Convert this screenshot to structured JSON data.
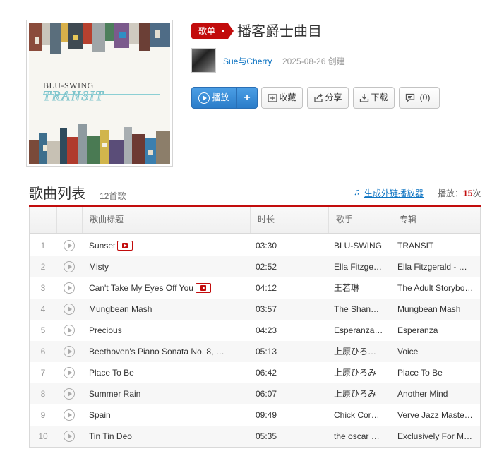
{
  "cover": {
    "artist": "BLU-SWING",
    "album": "TRANSIT"
  },
  "playlist": {
    "tag": "歌单",
    "title": "播客爵士曲目",
    "creator": "Sue与Cherry",
    "created": "2025-08-26 创建"
  },
  "actions": {
    "play": "播放",
    "add": "+",
    "favorite": "收藏",
    "share": "分享",
    "download": "下载",
    "comment": "(0)"
  },
  "songlist": {
    "title": "歌曲列表",
    "count": "12首歌",
    "gen_player": "生成外链播放器",
    "plays_label": "播放：",
    "plays_value": "15",
    "plays_unit": "次"
  },
  "table": {
    "headers": [
      "歌曲标题",
      "时长",
      "歌手",
      "专辑"
    ],
    "rows": [
      {
        "no": "1",
        "title": "Sunset",
        "mv": true,
        "duration": "03:30",
        "artist": "BLU-SWING",
        "album": "TRANSIT"
      },
      {
        "no": "2",
        "title": "Misty",
        "mv": false,
        "duration": "02:52",
        "artist": "Ella Fitzge…",
        "album": "Ella Fitzgerald - …"
      },
      {
        "no": "3",
        "title": "Can't Take My Eyes Off You",
        "mv": true,
        "duration": "04:12",
        "artist": "王若琳",
        "album": "The Adult Storybo…"
      },
      {
        "no": "4",
        "title": "Mungbean Mash",
        "mv": false,
        "duration": "03:57",
        "artist": "The Shan…",
        "album": "Mungbean Mash"
      },
      {
        "no": "5",
        "title": "Precious",
        "mv": false,
        "duration": "04:23",
        "artist": "Esperanza…",
        "album": "Esperanza"
      },
      {
        "no": "6",
        "title": "Beethoven's Piano Sonata No. 8, …",
        "mv": false,
        "duration": "05:13",
        "artist": "上原ひろ…",
        "album": "Voice"
      },
      {
        "no": "7",
        "title": "Place To Be",
        "mv": false,
        "duration": "06:42",
        "artist": "上原ひろみ",
        "album": "Place To Be"
      },
      {
        "no": "8",
        "title": "Summer Rain",
        "mv": false,
        "duration": "06:07",
        "artist": "上原ひろみ",
        "album": "Another Mind"
      },
      {
        "no": "9",
        "title": "Spain",
        "mv": false,
        "duration": "09:49",
        "artist": "Chick Cor…",
        "album": "Verve Jazz Maste…"
      },
      {
        "no": "10",
        "title": "Tin Tin Deo",
        "mv": false,
        "duration": "05:35",
        "artist": "the oscar …",
        "album": "Exclusively For M…"
      }
    ]
  },
  "colors": {
    "accent": "#c20c0c",
    "link": "#0c73c2",
    "play_button": "#2a7cc9"
  }
}
